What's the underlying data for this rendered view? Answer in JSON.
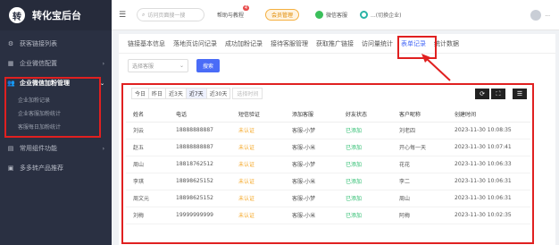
{
  "sidebar": {
    "logo_glyph": "转",
    "title": "转化宝后台",
    "items": [
      {
        "icon": "gear-icon",
        "icon_glyph": "⚙",
        "label": "获客链接列表"
      },
      {
        "icon": "grid-icon",
        "icon_glyph": "▦",
        "label": "企业微信配置"
      },
      {
        "icon": "users-icon",
        "icon_glyph": "👥",
        "label": "企业微信加粉管理",
        "active": true
      },
      {
        "icon": "apps-icon",
        "icon_glyph": "▤",
        "label": "常用组件功能"
      },
      {
        "icon": "box-icon",
        "icon_glyph": "▣",
        "label": "多多转产品推荐"
      }
    ],
    "sub_items": [
      "企业加粉记录",
      "企业客服加粉统计",
      "客服每日加粉统计"
    ]
  },
  "topbar": {
    "search_placeholder": "访问页面搜一搜",
    "help_label": "帮助与教程",
    "help_badge": "4",
    "upgrade_label": "会员管理",
    "wechat_label": "微信客服",
    "enterprise_label": "...(切换企业)",
    "user_label": "..."
  },
  "tabs": [
    {
      "label": "链接基本信息",
      "active": false
    },
    {
      "label": "落地页访问记录",
      "active": false
    },
    {
      "label": "成功加粉记录",
      "active": false
    },
    {
      "label": "接待客服管理",
      "active": false
    },
    {
      "label": "获取推广链接",
      "active": false
    },
    {
      "label": "访问量统计",
      "active": false
    },
    {
      "label": "表单记录",
      "active": true
    },
    {
      "label": "统计数据",
      "active": false
    }
  ],
  "filter": {
    "select_placeholder": "选择客服",
    "search_button": "搜索"
  },
  "date_filters": [
    {
      "label": "今日",
      "active": false
    },
    {
      "label": "昨日",
      "active": false
    },
    {
      "label": "近3天",
      "active": false
    },
    {
      "label": "近7天",
      "active": true
    },
    {
      "label": "近30天",
      "active": false
    }
  ],
  "date_range_placeholder": "选择时间",
  "tool_buttons": [
    {
      "icon": "refresh-icon",
      "glyph": "⟳"
    },
    {
      "icon": "fullscreen-icon",
      "glyph": "⛶"
    },
    {
      "icon": "list-icon",
      "glyph": "☰"
    }
  ],
  "table": {
    "columns": [
      "姓名",
      "电话",
      "短信验证",
      "添加客服",
      "好友状态",
      "客户昵称",
      "创建时间"
    ],
    "rows": [
      [
        "刘云",
        "18888888887",
        "未认证",
        "客服-小梦",
        "已添加",
        "刘老四",
        "2023-11-30 10:08:35"
      ],
      [
        "赵五",
        "18888888887",
        "未认证",
        "客服-小米",
        "已添加",
        "开心每一天",
        "2023-11-30 10:07:41"
      ],
      [
        "周山",
        "18818762512",
        "未认证",
        "客服-小梦",
        "已添加",
        "花花",
        "2023-11-30 10:06:33"
      ],
      [
        "李琪",
        "18898625152",
        "未认证",
        "客服-小米",
        "已添加",
        "李二",
        "2023-11-30 10:06:31"
      ],
      [
        "周文元",
        "18898625152",
        "未认证",
        "客服-小梦",
        "已添加",
        "周山",
        "2023-11-30 10:06:31"
      ],
      [
        "刘梅",
        "19999999999",
        "未认证",
        "客服-小米",
        "已添加",
        "阿梅",
        "2023-11-30 10:02:35"
      ]
    ]
  },
  "colors": {
    "accent": "#4a6cf7",
    "highlight_box": "#e02020",
    "sidebar_bg": "#2a3042",
    "status_unverified": "#f5a623",
    "status_added": "#2fbf71"
  }
}
